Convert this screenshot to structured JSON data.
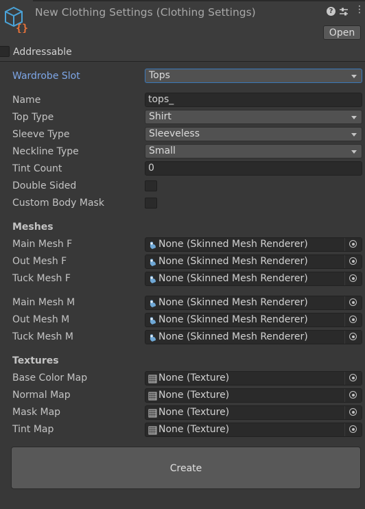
{
  "header": {
    "title": "New Clothing Settings (Clothing Settings)",
    "open_label": "Open",
    "addressable_label": "Addressable",
    "icons": [
      "scriptable-object-icon",
      "help-icon",
      "presets-icon",
      "more-options-icon"
    ]
  },
  "colors": {
    "accent_label": "#7ea7e8",
    "focus_border": "#3a79bb",
    "icon_orange": "#e8733a",
    "icon_blue": "#4aa3d8"
  },
  "wardrobe": {
    "label": "Wardrobe Slot",
    "value": "Tops"
  },
  "fields": {
    "name": {
      "label": "Name",
      "value": "tops_"
    },
    "top_type": {
      "label": "Top Type",
      "value": "Shirt"
    },
    "sleeve_type": {
      "label": "Sleeve Type",
      "value": "Sleeveless"
    },
    "neckline_type": {
      "label": "Neckline Type",
      "value": "Small"
    },
    "tint_count": {
      "label": "Tint Count",
      "value": "0"
    },
    "double_sided": {
      "label": "Double Sided",
      "checked": false
    },
    "custom_body_mask": {
      "label": "Custom Body Mask",
      "checked": false
    }
  },
  "meshes": {
    "heading": "Meshes",
    "items": [
      {
        "label": "Main Mesh F",
        "value": "None (Skinned Mesh Renderer)"
      },
      {
        "label": "Out Mesh F",
        "value": "None (Skinned Mesh Renderer)"
      },
      {
        "label": "Tuck Mesh F",
        "value": "None (Skinned Mesh Renderer)"
      },
      {
        "label": "Main Mesh M",
        "value": "None (Skinned Mesh Renderer)"
      },
      {
        "label": "Out Mesh M",
        "value": "None (Skinned Mesh Renderer)"
      },
      {
        "label": "Tuck Mesh M",
        "value": "None (Skinned Mesh Renderer)"
      }
    ]
  },
  "textures": {
    "heading": "Textures",
    "items": [
      {
        "label": "Base Color Map",
        "value": "None (Texture)"
      },
      {
        "label": "Normal Map",
        "value": "None (Texture)"
      },
      {
        "label": "Mask Map",
        "value": "None (Texture)"
      },
      {
        "label": "Tint Map",
        "value": "None (Texture)"
      }
    ]
  },
  "create_label": "Create"
}
